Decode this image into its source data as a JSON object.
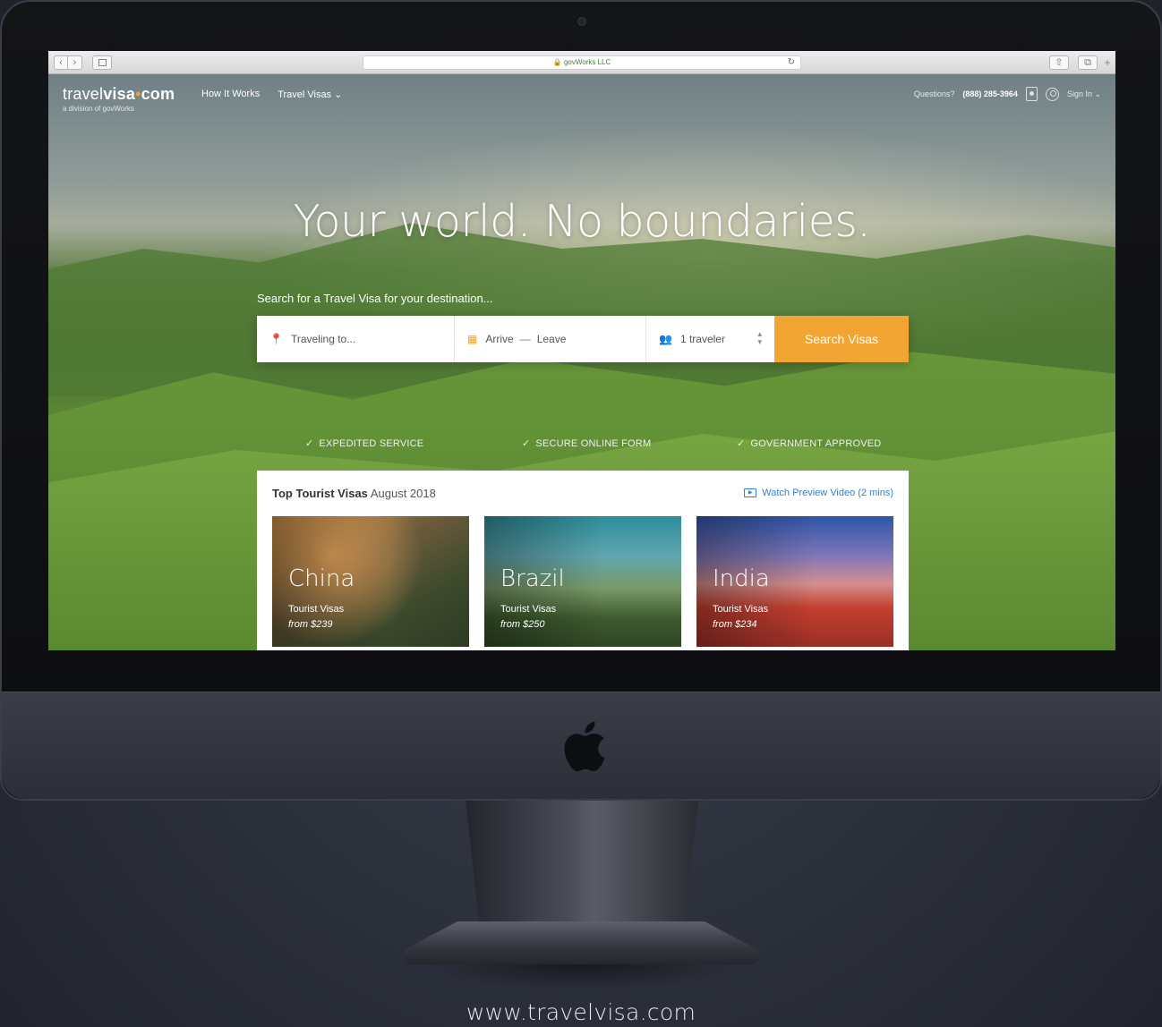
{
  "browser": {
    "address": "govWorks LLC",
    "back_symbol": "‹",
    "forward_symbol": "›",
    "reload_symbol": "↻",
    "share_symbol": "⇧",
    "tabs_symbol": "⧉",
    "newtab_symbol": "+"
  },
  "site": {
    "logo_light": "travel",
    "logo_bold": "visa",
    "logo_dot": "•",
    "logo_tld": "com",
    "logo_sub": "a division of govWorks",
    "nav": {
      "how_it_works": "How It Works",
      "travel_visas": "Travel Visas ⌄"
    },
    "questions_label": "Questions?",
    "phone": "(888) 285-3964",
    "sign_in": "Sign In ⌄"
  },
  "hero": {
    "headline": "Your world. No boundaries.",
    "search_label": "Search for a Travel Visa for your destination...",
    "destination_placeholder": "Traveling to...",
    "arrive": "Arrive",
    "dash": "—",
    "leave": "Leave",
    "travelers": "1 traveler",
    "search_button": "Search Visas",
    "features": [
      "EXPEDITED SERVICE",
      "SECURE ONLINE FORM",
      "GOVERNMENT APPROVED"
    ]
  },
  "top_visas": {
    "title": "Top Tourist Visas",
    "month": "August 2018",
    "video_link": "Watch Preview Video (2 mins)",
    "cards": [
      {
        "country": "China",
        "type": "Tourist Visas",
        "price": "from $239"
      },
      {
        "country": "Brazil",
        "type": "Tourist Visas",
        "price": "from $250"
      },
      {
        "country": "India",
        "type": "Tourist Visas",
        "price": "from $234"
      }
    ]
  },
  "footer_url": "www.travelvisa.com",
  "colors": {
    "accent": "#f2a533",
    "link": "#2f7fcf",
    "secure": "#3a8a2e"
  },
  "icons": {
    "destination": "map-pin-icon",
    "dates": "calendar-icon",
    "travelers": "people-icon",
    "feature": "check-circle-icon",
    "video": "play-icon",
    "brand": "apple-logo"
  }
}
